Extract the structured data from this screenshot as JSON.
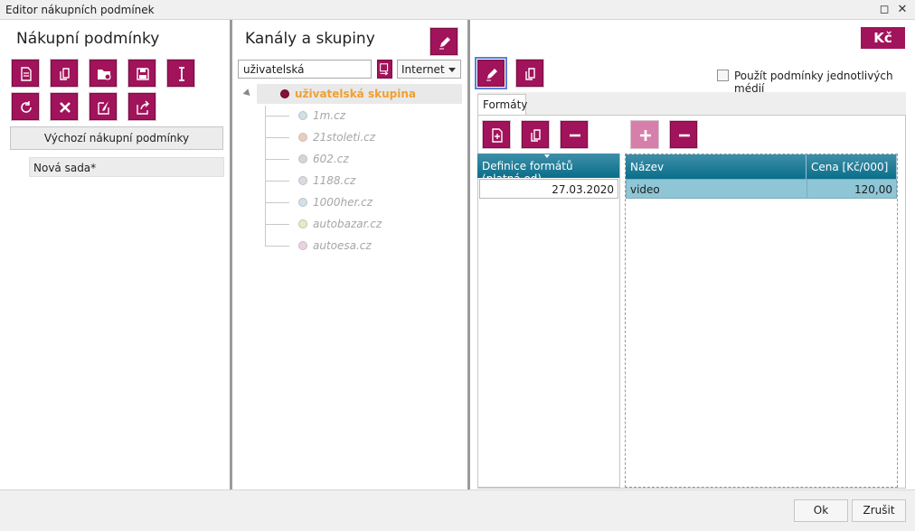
{
  "window": {
    "title": "Editor nákupních podmínek",
    "restore_icon": "restore-icon",
    "close_icon": "close-icon",
    "restore_glyph": "◻",
    "close_glyph": "✕"
  },
  "left_pane": {
    "title": "Nákupní podmínky",
    "toolbar_icons": [
      "new-document-icon",
      "copy-icon",
      "open-folder-icon",
      "save-icon",
      "rename-icon",
      "refresh-icon",
      "delete-icon",
      "import-icon",
      "export-icon"
    ],
    "default_button_label": "Výchozí nákupní podmínky",
    "sets": [
      {
        "label": "Nová sada*"
      }
    ]
  },
  "middle_pane": {
    "title": "Kanály a skupiny",
    "edit_icon": "pencil-icon",
    "search_value": "uživatelská",
    "filter_icon": "filter-icon",
    "type_select": "Internet",
    "tree": {
      "root": {
        "label": "uživatelská skupina",
        "color": "#8a1038"
      },
      "children": [
        {
          "label": "1m.cz",
          "color": "#cfe0e6"
        },
        {
          "label": "21stoleti.cz",
          "color": "#efcbb7"
        },
        {
          "label": "602.cz",
          "color": "#d4d9cf"
        },
        {
          "label": "1188.cz",
          "color": "#d7dbe4"
        },
        {
          "label": "1000her.cz",
          "color": "#cfe2ec"
        },
        {
          "label": "autobazar.cz",
          "color": "#e6ecbf"
        },
        {
          "label": "autoesa.cz",
          "color": "#ecd1e6"
        }
      ]
    }
  },
  "right_pane": {
    "currency_button": "Kč",
    "edit_icon": "pencil-icon",
    "copy_icon": "copy-icon",
    "checkbox_label": "Použít podmínky jednotlivých médií",
    "checkbox_checked": false,
    "tab_label": "Formáty",
    "left_toolbar_icons": [
      "add-document-icon",
      "copy-icon",
      "minus-icon"
    ],
    "right_toolbar_icons": [
      "plus-icon",
      "minus-icon"
    ],
    "definitions_grid": {
      "header": "Definice formátů (platná od)",
      "rows": [
        "27.03.2020"
      ]
    },
    "formats_grid": {
      "headers": {
        "name": "Název",
        "price": "Cena [Kč/000]"
      },
      "rows": [
        {
          "name": "video",
          "price": "120,00"
        }
      ]
    }
  },
  "footer": {
    "ok_label": "Ok",
    "cancel_label": "Zrušit"
  },
  "colors": {
    "accent": "#a1135a",
    "grid_header": "#0a6e8a",
    "selected_row": "#8fc6d6"
  }
}
